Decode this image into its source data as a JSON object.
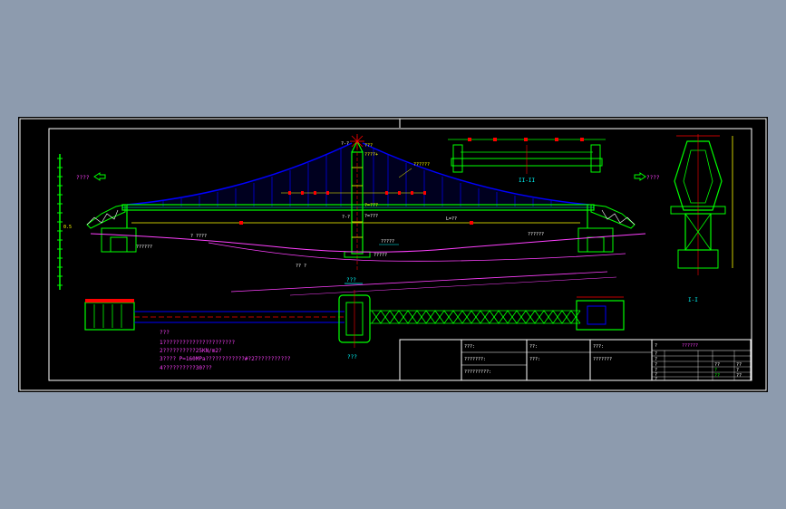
{
  "colors": {
    "workspace": "#8d9bae",
    "paper": "#000000",
    "frame": "#ffffff",
    "structure": "#00ff00",
    "cable": "#0000ff",
    "deck": "#ffff00",
    "ground": "#ff40ff",
    "dims": "#ff0000",
    "labels": "#00ffff"
  },
  "labels": {
    "left_arrow": "????",
    "right_arrow": "????",
    "elevation_view": "???",
    "section_ii": "II-II",
    "section_i": "I-I",
    "plan_view": "???",
    "top_mark": "???",
    "tower_mark_1": "????+",
    "tower_mark_2": "?=???",
    "deck_mark": "?=???",
    "span_mark": "L=??",
    "ground_left": "??????",
    "ground_right": "??????",
    "water_level": "?????"
  },
  "notes": {
    "title": "???",
    "lines": [
      "1??????????????????????",
      "2??????????25KN/m2?",
      "3????  P=160MPa????????????#?27??????????",
      "4??????????30???"
    ]
  },
  "title_block": {
    "c1r1": "???:",
    "c1r2": "???????:",
    "c1r3": "?????????:",
    "c2r1": "??:",
    "c2r2": "???:",
    "c3r1": "???:",
    "c3r2": "???????",
    "c4r1": "?",
    "c4r2": "??????",
    "small_rows": [
      "?",
      "?",
      "?",
      "?",
      "?",
      "?"
    ],
    "small_values": [
      "??",
      "?",
      "??",
      "??",
      "?",
      "??"
    ]
  }
}
